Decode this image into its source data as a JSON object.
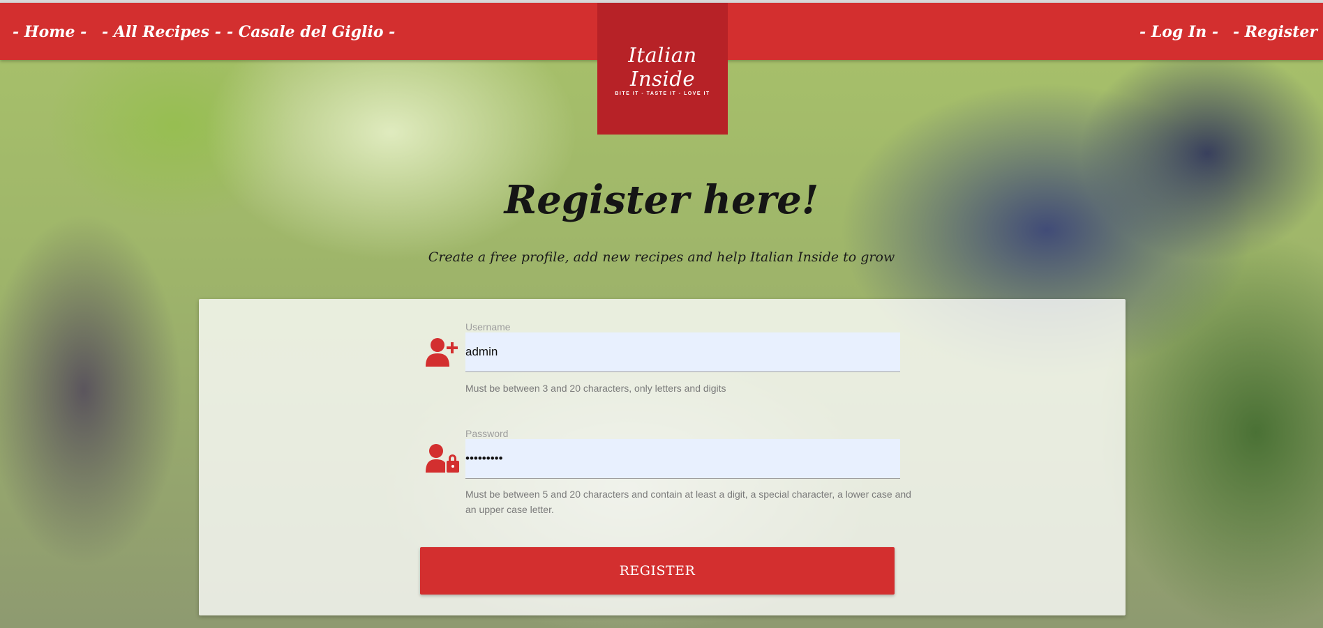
{
  "nav": {
    "home": "- Home -",
    "all_recipes": "- All Recipes -",
    "casale": "- Casale del Giglio -",
    "login": "- Log In -",
    "register": "- Register -"
  },
  "logo": {
    "name": "Italian Inside",
    "tagline": "BITE IT - TASTE IT - LOVE IT"
  },
  "hero": {
    "title": "Register here!",
    "subtitle": "Create a free profile, add new recipes and help Italian Inside to grow"
  },
  "form": {
    "username": {
      "label": "Username",
      "value": "admin",
      "help": "Must be between 3 and 20 characters, only letters and digits",
      "icon": "user-plus-icon"
    },
    "password": {
      "label": "Password",
      "value": "•••••••••",
      "help": "Must be between 5 and 20 characters and contain at least a digit, a special character, a lower case and an upper case letter.",
      "icon": "user-lock-icon"
    },
    "submit_label": "REGISTER"
  },
  "colors": {
    "primary": "#d32f2f",
    "logo_bg": "#b72227",
    "input_bg": "#e8f0fe"
  }
}
